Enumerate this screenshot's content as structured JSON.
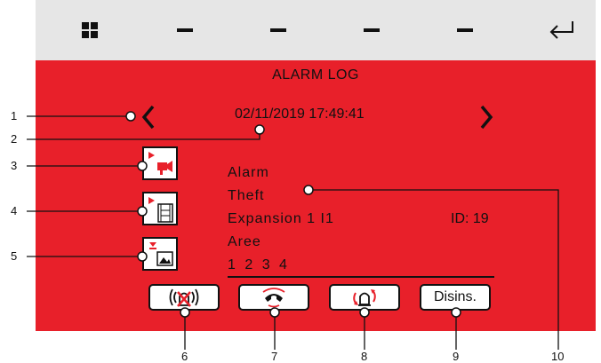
{
  "header": {
    "buttons": [
      {
        "icon": "grid-icon"
      },
      {
        "icon": "dash-icon"
      },
      {
        "icon": "dash-icon"
      },
      {
        "icon": "dash-icon"
      },
      {
        "icon": "dash-icon"
      },
      {
        "icon": "return-arrow-icon"
      }
    ]
  },
  "screen": {
    "title": "ALARM LOG",
    "datetime": "02/11/2019  17:49:41",
    "prev_icon": "<",
    "next_icon": ">",
    "event": {
      "line1": "Alarm",
      "line2": "Theft",
      "line3": "Expansion 1 I1",
      "id_text": "ID: 19",
      "line4": "Aree",
      "line5": "1 2 3 4"
    },
    "actions": [
      {
        "icon": "siren-muted-icon"
      },
      {
        "icon": "phone-call-icon"
      },
      {
        "icon": "alarm-reset-icon"
      },
      {
        "label": "Disins."
      }
    ]
  },
  "callouts": [
    "1",
    "2",
    "3",
    "4",
    "5",
    "6",
    "7",
    "8",
    "9",
    "10"
  ],
  "colors": {
    "screen_bg": "#e8202a",
    "topbar_bg": "#e6e6e6",
    "accent_red": "#e8202a"
  }
}
